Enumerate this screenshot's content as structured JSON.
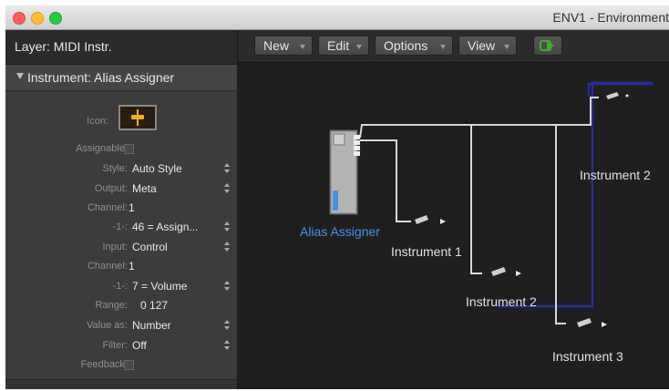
{
  "window": {
    "title": "ENV1 - Environment"
  },
  "inspector": {
    "layer": "Layer: MIDI Instr.",
    "instrument_header": "Instrument: Alias Assigner",
    "icon_label": "Icon:",
    "params": [
      {
        "label": "Assignable:",
        "type": "checkbox"
      },
      {
        "label": "Style:",
        "value": "Auto Style",
        "type": "popup"
      },
      {
        "label": "Output:",
        "value": "Meta",
        "type": "popup"
      },
      {
        "label": "Channel:",
        "value": "1",
        "type": "channel"
      },
      {
        "label": "-1-:",
        "value": "46 = Assign...",
        "type": "popup"
      },
      {
        "label": "Input:",
        "value": "Control",
        "type": "popup"
      },
      {
        "label": "Channel:",
        "value": "1",
        "type": "channel"
      },
      {
        "label": "-1-:",
        "value": "7 = Volume",
        "type": "popup"
      },
      {
        "label": "Range:",
        "value": "0  127",
        "type": "text"
      },
      {
        "label": "Value as:",
        "value": "Number",
        "type": "popup"
      },
      {
        "label": "Filter:",
        "value": "Off",
        "type": "popup"
      },
      {
        "label": "Feedback:",
        "type": "checkbox"
      }
    ]
  },
  "toolbar": {
    "new": "New",
    "edit": "Edit",
    "options": "Options",
    "view": "View"
  },
  "environment": {
    "objects": {
      "alias_assigner": "Alias Assigner",
      "instrument_1": "Instrument 1",
      "instrument_2_lower": "Instrument 2",
      "instrument_2_upper": "Instrument 2",
      "instrument_3": "Instrument 3"
    }
  },
  "colors": {
    "cable_white": "#d8d8d8",
    "cable_blue": "#2a2a9c",
    "selected_label": "#4a8fe7",
    "link_green": "#3fae2d",
    "icon_gold": "#f1b21c"
  }
}
